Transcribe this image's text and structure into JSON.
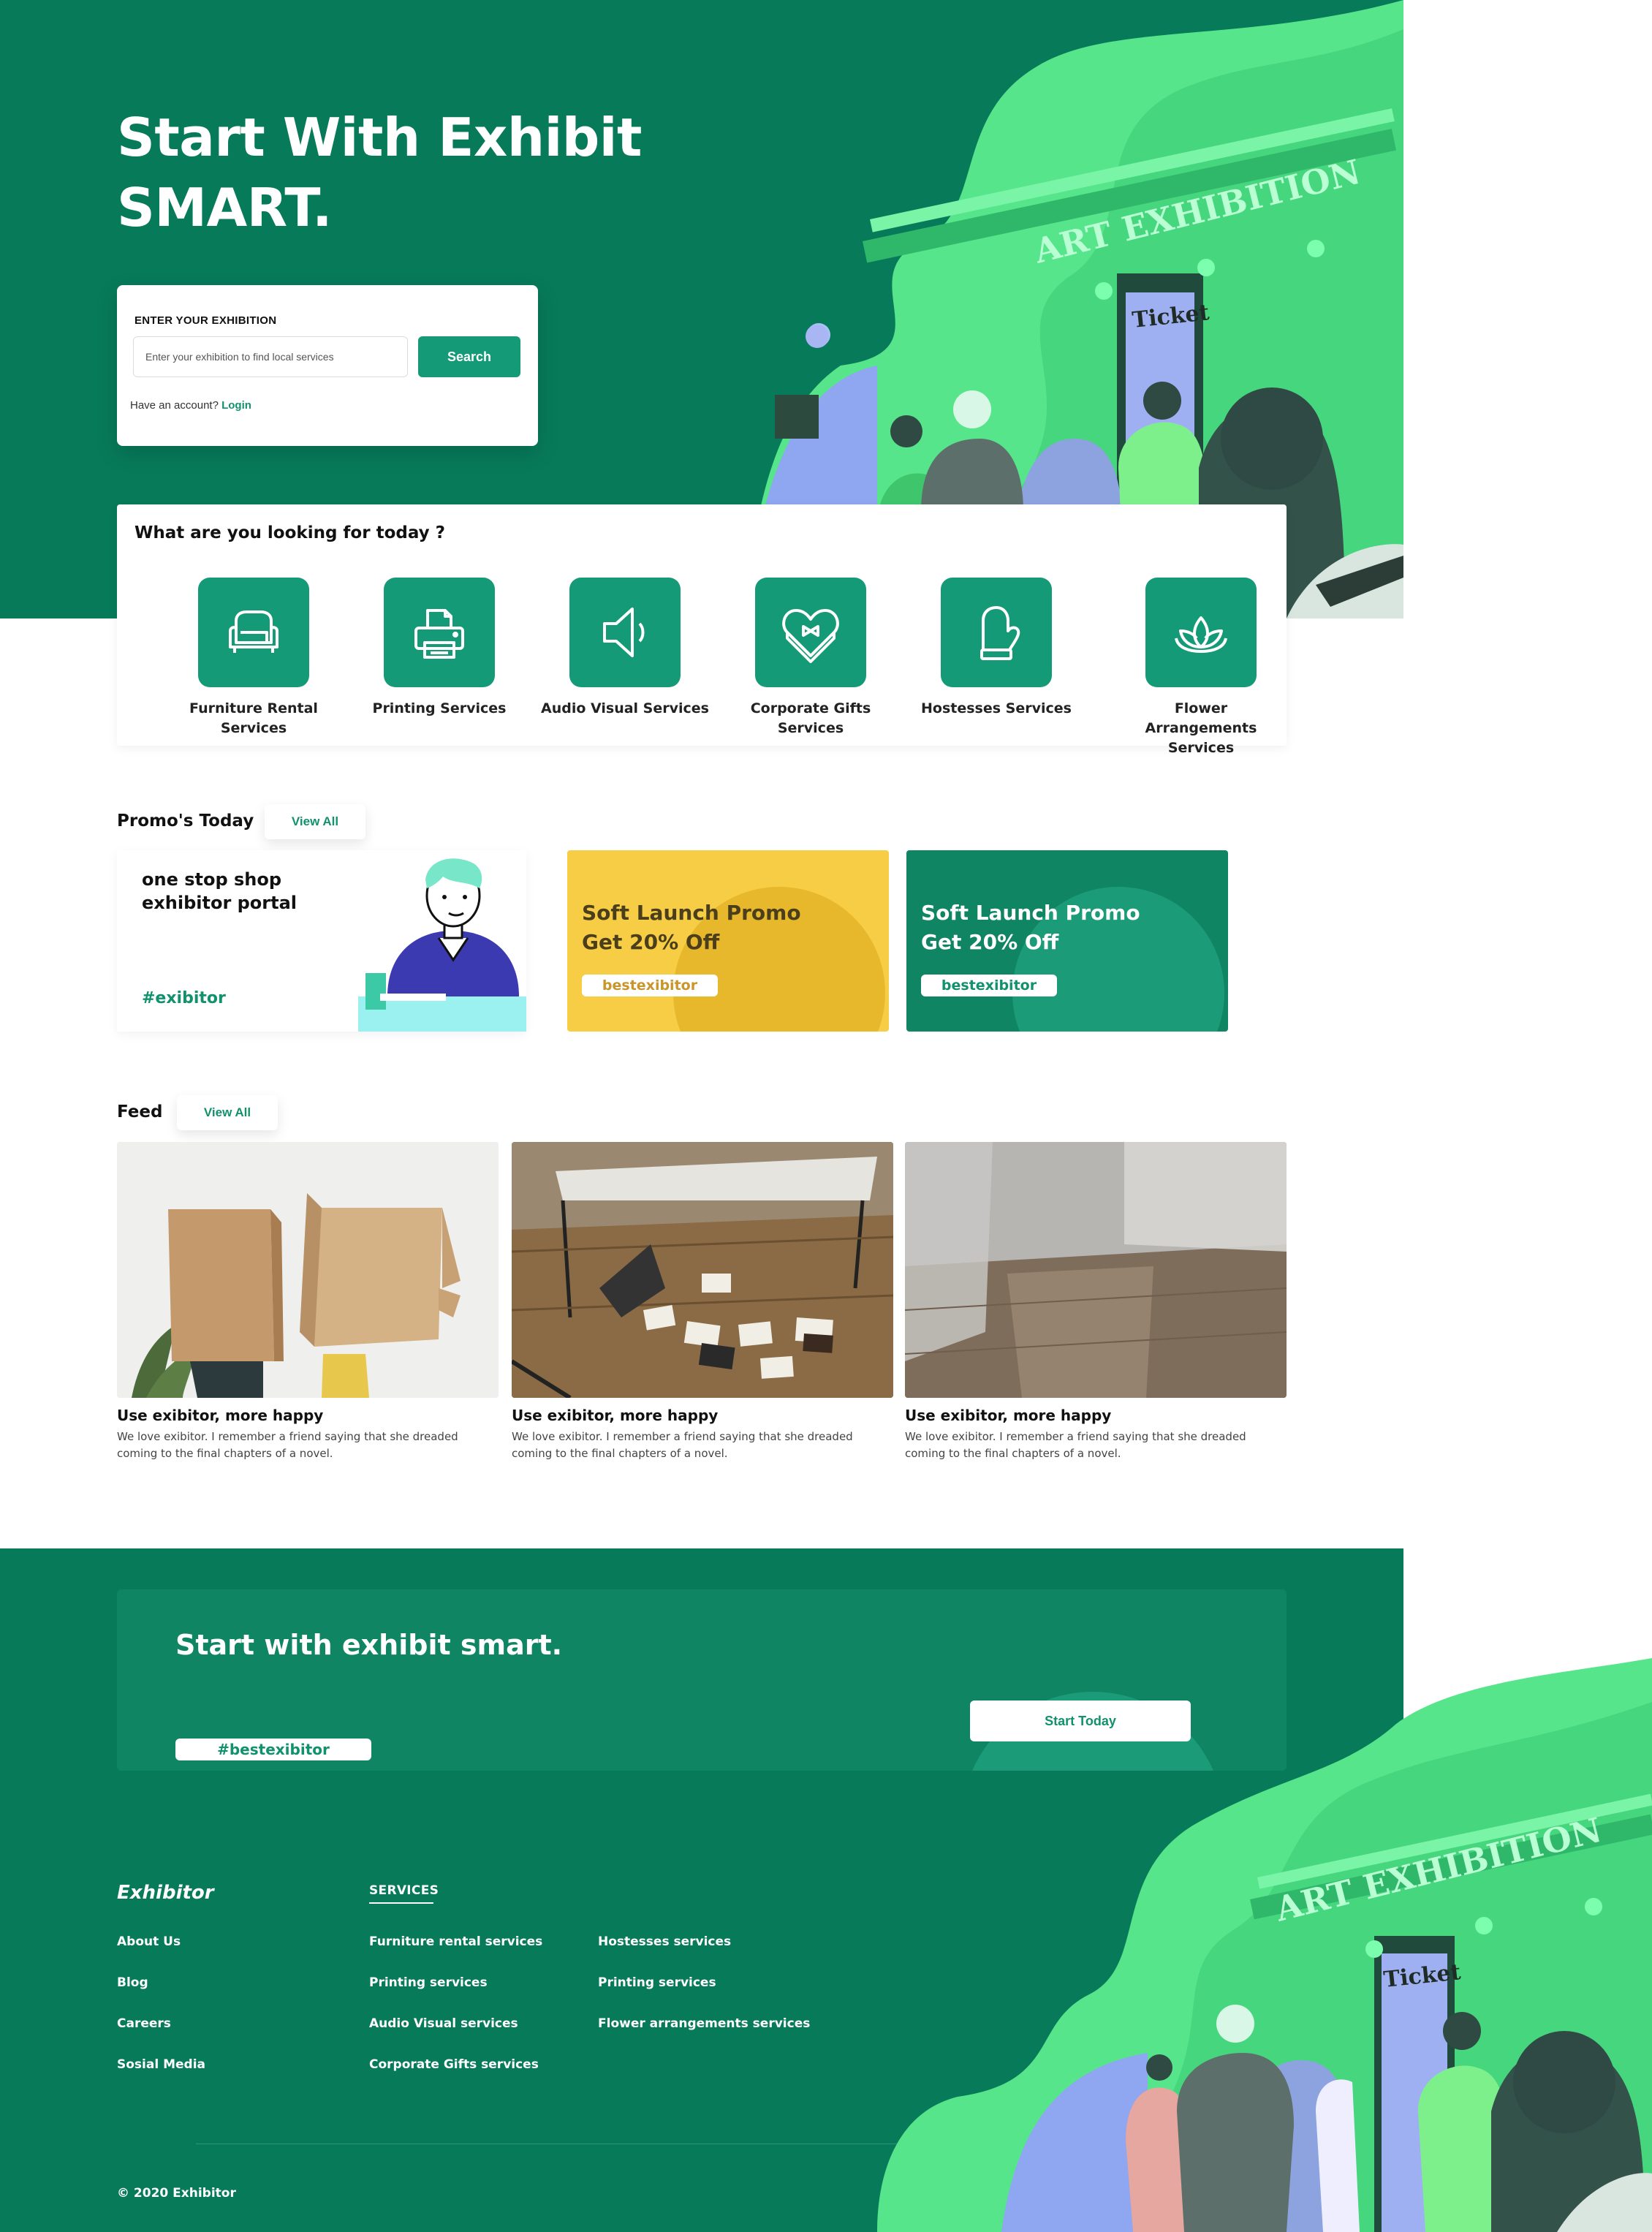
{
  "hero": {
    "title_line1": "Start With Exhibit",
    "title_line2": "SMART.",
    "art_sign": "ART EXHIBITION",
    "art_ticket": "Ticket"
  },
  "search": {
    "label": "ENTER YOUR EXHIBITION",
    "placeholder": "Enter your exhibition to find local services",
    "button": "Search",
    "account_prompt": "Have an account?",
    "login": "Login"
  },
  "categories": {
    "heading": "What are you looking for today ?",
    "items": [
      {
        "label": "Furniture Rental Services",
        "icon": "armchair-icon"
      },
      {
        "label": "Printing Services",
        "icon": "printer-icon"
      },
      {
        "label": "Audio Visual Services",
        "icon": "speaker-icon"
      },
      {
        "label": "Corporate Gifts Services",
        "icon": "gift-heart-icon"
      },
      {
        "label": "Hostesses Services",
        "icon": "glove-icon"
      },
      {
        "label": "Flower Arrangements Services",
        "icon": "lotus-icon"
      }
    ]
  },
  "promos": {
    "heading": "Promo's Today",
    "view_all": "View All",
    "feature": {
      "title": "one stop shop exhibitor portal",
      "tag": "#exibitor"
    },
    "cards": [
      {
        "line1": "Soft Launch Promo",
        "line2": "Get 20% Off",
        "code": "bestexibitor",
        "bg": "#f6cd45",
        "circle": "#e8b82c",
        "text": "#4a3f1a",
        "code_color": "#c9962a"
      },
      {
        "line1": "Soft Launch Promo",
        "line2": "Get 20% Off",
        "code": "bestexibitor",
        "bg": "#0f8563",
        "circle": "#1b9b78",
        "text": "#ffffff",
        "code_color": "#12916d"
      }
    ]
  },
  "feed": {
    "heading": "Feed",
    "view_all": "View All",
    "items": [
      {
        "title": "Use exibitor, more happy",
        "desc": "We love exibitor. I remember a friend saying that she dreaded coming to the final chapters of a novel."
      },
      {
        "title": "Use exibitor, more happy",
        "desc": "We love exibitor. I remember a friend saying that she dreaded coming to the final chapters of a novel."
      },
      {
        "title": "Use exibitor, more happy",
        "desc": "We love exibitor. I remember a friend saying that she dreaded coming to the final chapters of a novel."
      }
    ]
  },
  "cta": {
    "title": "Start with exhibit smart.",
    "tag": "#bestexibitor",
    "button": "Start Today"
  },
  "footer": {
    "brand": "Exhibitor",
    "services_heading": "SERVICES",
    "company_links": [
      "About Us",
      "Blog",
      "Careers",
      "Sosial Media"
    ],
    "service_links_col1": [
      "Furniture rental services",
      "Printing services",
      "Audio Visual services",
      "Corporate Gifts services"
    ],
    "service_links_col2": [
      "Hostesses services",
      "Printing services",
      "Flower arrangements services"
    ],
    "copyright": "© 2020 Exhibitor"
  },
  "colors": {
    "primary": "#077a5a",
    "accent": "#159a77",
    "link": "#12916d",
    "promo_yellow": "#f6cd45"
  }
}
